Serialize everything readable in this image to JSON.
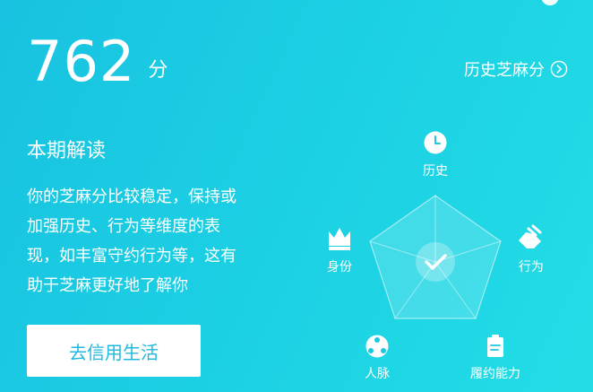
{
  "score": {
    "value": "762",
    "unit": "分"
  },
  "history_link": {
    "label": "历史芝麻分",
    "icon": "chevron-right-circle-icon"
  },
  "interpretation": {
    "title": "本期解读",
    "lines": [
      "你的芝麻分比较稳定，保持或",
      "加强历史、行为等维度的表",
      "现，如丰富守约行为等，这有",
      "助于芝麻更好地了解你"
    ]
  },
  "cta": {
    "label": "去信用生活"
  },
  "radar": {
    "center_icon": "checkmark-icon",
    "dimensions": [
      {
        "label": "历史",
        "icon": "clock-icon"
      },
      {
        "label": "行为",
        "icon": "handshake-icon"
      },
      {
        "label": "履约能力",
        "icon": "document-icon"
      },
      {
        "label": "人脉",
        "icon": "people-icon"
      },
      {
        "label": "身份",
        "icon": "crown-icon"
      }
    ]
  },
  "colors": {
    "background_start": "#18c2e0",
    "background_end": "#22dde6",
    "accent_text": "#20b9dc",
    "foreground": "#ffffff"
  }
}
